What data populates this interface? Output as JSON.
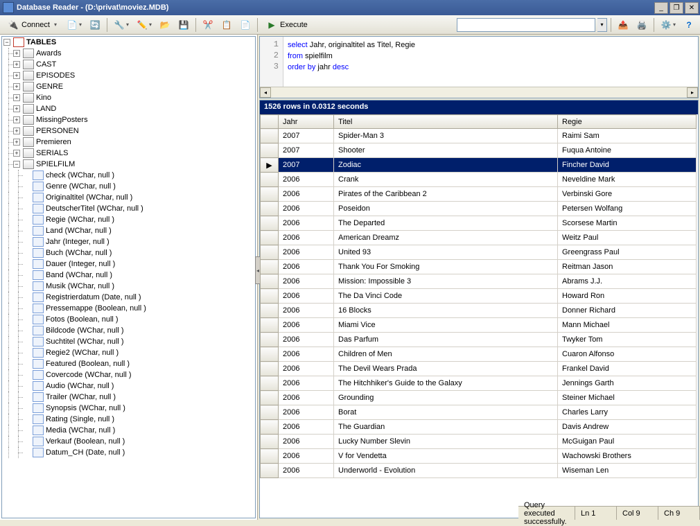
{
  "window": {
    "title": "Database Reader - (D:\\privat\\moviez.MDB)"
  },
  "toolbar": {
    "connect_label": "Connect",
    "execute_label": "Execute"
  },
  "tree": {
    "root_label": "TABLES",
    "tables": [
      {
        "name": "Awards",
        "expanded": false
      },
      {
        "name": "CAST",
        "expanded": false
      },
      {
        "name": "EPISODES",
        "expanded": false
      },
      {
        "name": "GENRE",
        "expanded": false
      },
      {
        "name": "Kino",
        "expanded": false
      },
      {
        "name": "LAND",
        "expanded": false
      },
      {
        "name": "MissingPosters",
        "expanded": false
      },
      {
        "name": "PERSONEN",
        "expanded": false
      },
      {
        "name": "Premieren",
        "expanded": false
      },
      {
        "name": "SERIALS",
        "expanded": false
      },
      {
        "name": "SPIELFILM",
        "expanded": true
      }
    ],
    "columns": [
      "check (WChar, null )",
      "Genre (WChar, null )",
      "Originaltitel (WChar, null )",
      "DeutscherTitel (WChar, null )",
      "Regie (WChar, null )",
      "Land (WChar, null )",
      "Jahr (Integer, null )",
      "Buch (WChar, null )",
      "Dauer (Integer, null )",
      "Band (WChar, null )",
      "Musik (WChar, null )",
      "Registrierdatum (Date, null )",
      "Pressemappe (Boolean, null )",
      "Fotos (Boolean, null )",
      "Bildcode (WChar, null )",
      "Suchtitel (WChar, null )",
      "Regie2 (WChar, null )",
      "Featured (Boolean, null )",
      "Covercode (WChar, null )",
      "Audio (WChar, null )",
      "Trailer (WChar, null )",
      "Synopsis (WChar, null )",
      "Rating (Single, null )",
      "Media (WChar, null )",
      "Verkauf (Boolean, null )",
      "Datum_CH (Date, null )"
    ]
  },
  "sql": {
    "line1_kw1": "select",
    "line1_rest": " Jahr, originaltitel as Titel, Regie",
    "line2_kw1": "from",
    "line2_rest": " spielfilm",
    "line3_kw1": "order by",
    "line3_rest": " jahr ",
    "line3_kw2": "desc"
  },
  "results": {
    "summary": "1526 rows in 0.0312 seconds",
    "headers": [
      "Jahr",
      "Titel",
      "Regie"
    ],
    "selected_index": 2,
    "rows": [
      {
        "jahr": "2007",
        "titel": "Spider-Man 3",
        "regie": "Raimi Sam"
      },
      {
        "jahr": "2007",
        "titel": "Shooter",
        "regie": "Fuqua Antoine"
      },
      {
        "jahr": "2007",
        "titel": "Zodiac",
        "regie": "Fincher David"
      },
      {
        "jahr": "2006",
        "titel": "Crank",
        "regie": "Neveldine Mark"
      },
      {
        "jahr": "2006",
        "titel": "Pirates of the Caribbean 2",
        "regie": "Verbinski Gore"
      },
      {
        "jahr": "2006",
        "titel": "Poseidon",
        "regie": "Petersen Wolfang"
      },
      {
        "jahr": "2006",
        "titel": "The Departed",
        "regie": "Scorsese Martin"
      },
      {
        "jahr": "2006",
        "titel": "American Dreamz",
        "regie": "Weitz Paul"
      },
      {
        "jahr": "2006",
        "titel": "United 93",
        "regie": "Greengrass Paul"
      },
      {
        "jahr": "2006",
        "titel": "Thank You For Smoking",
        "regie": "Reitman Jason"
      },
      {
        "jahr": "2006",
        "titel": "Mission: Impossible 3",
        "regie": "Abrams J.J."
      },
      {
        "jahr": "2006",
        "titel": "The Da Vinci Code",
        "regie": "Howard Ron"
      },
      {
        "jahr": "2006",
        "titel": "16 Blocks",
        "regie": "Donner Richard"
      },
      {
        "jahr": "2006",
        "titel": "Miami Vice",
        "regie": "Mann Michael"
      },
      {
        "jahr": "2006",
        "titel": "Das Parfum",
        "regie": "Twyker Tom"
      },
      {
        "jahr": "2006",
        "titel": "Children of Men",
        "regie": "Cuaron Alfonso"
      },
      {
        "jahr": "2006",
        "titel": "The Devil Wears Prada",
        "regie": "Frankel David"
      },
      {
        "jahr": "2006",
        "titel": "The Hitchhiker's Guide to the Galaxy",
        "regie": "Jennings Garth"
      },
      {
        "jahr": "2006",
        "titel": "Grounding",
        "regie": "Steiner Michael"
      },
      {
        "jahr": "2006",
        "titel": "Borat",
        "regie": "Charles Larry"
      },
      {
        "jahr": "2006",
        "titel": "The Guardian",
        "regie": "Davis Andrew"
      },
      {
        "jahr": "2006",
        "titel": "Lucky Number Slevin",
        "regie": "McGuigan Paul"
      },
      {
        "jahr": "2006",
        "titel": "V for Vendetta",
        "regie": "Wachowski Brothers"
      },
      {
        "jahr": "2006",
        "titel": "Underworld - Evolution",
        "regie": "Wiseman Len"
      }
    ]
  },
  "status": {
    "msg": "Query executed successfully.",
    "ln": "Ln 1",
    "col": "Col 9",
    "ch": "Ch 9"
  }
}
